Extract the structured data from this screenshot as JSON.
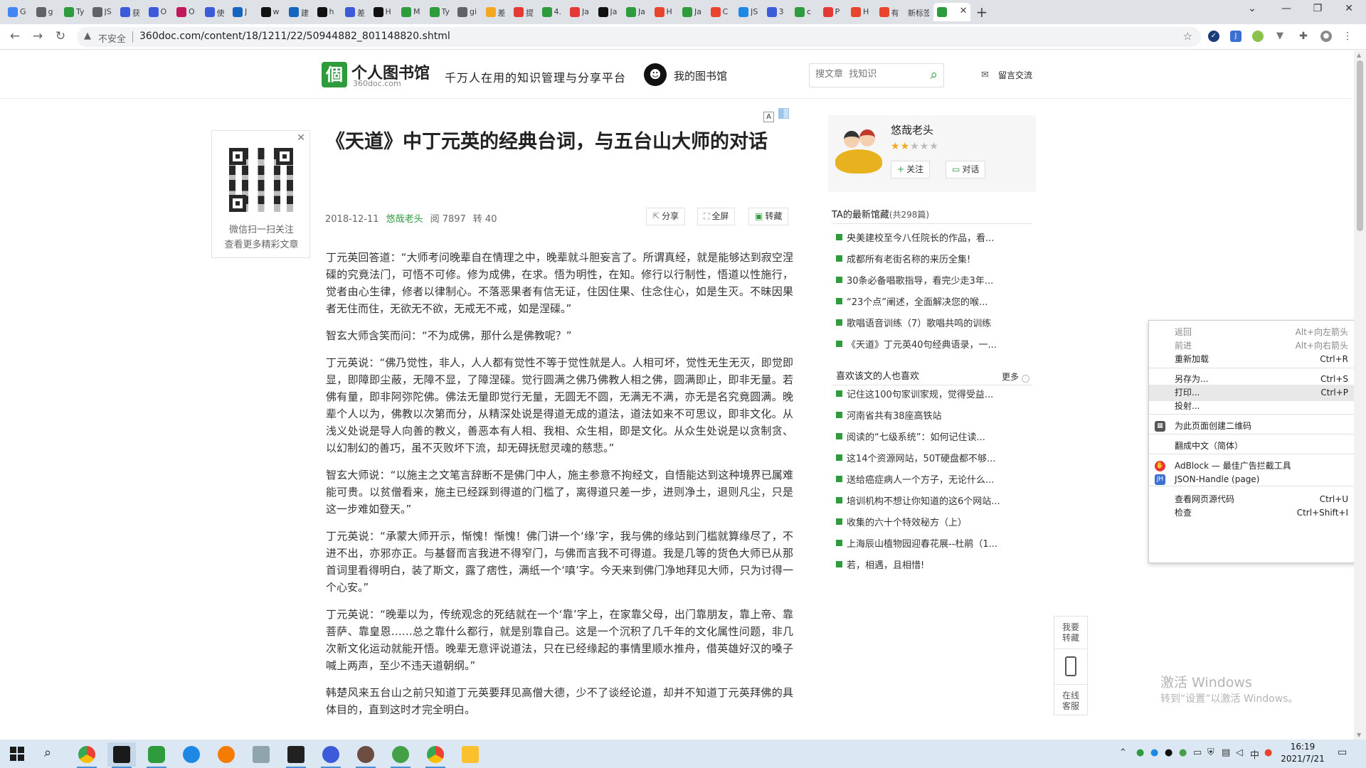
{
  "browser": {
    "tabs": [
      {
        "label": "G",
        "color": "#4285f4"
      },
      {
        "label": "g",
        "color": "#5f6368"
      },
      {
        "label": "Ty",
        "color": "#2e9b3c"
      },
      {
        "label": "JS",
        "color": "#5f6368"
      },
      {
        "label": "获",
        "color": "#3b5bdb"
      },
      {
        "label": "O",
        "color": "#3b5bdb"
      },
      {
        "label": "O",
        "color": "#c2185b"
      },
      {
        "label": "使",
        "color": "#3b5bdb"
      },
      {
        "label": "J",
        "color": "#1565c0"
      },
      {
        "label": "w",
        "color": "#111111"
      },
      {
        "label": "建",
        "color": "#1565c0"
      },
      {
        "label": "h",
        "color": "#111111"
      },
      {
        "label": "差",
        "color": "#3b5bdb"
      },
      {
        "label": "H",
        "color": "#111111"
      },
      {
        "label": "M",
        "color": "#2e9b3c"
      },
      {
        "label": "Ty",
        "color": "#2e9b3c"
      },
      {
        "label": "gi",
        "color": "#5f6368"
      },
      {
        "label": "差",
        "color": "#f5a623"
      },
      {
        "label": "提",
        "color": "#e53935"
      },
      {
        "label": "4.",
        "color": "#2e9b3c"
      },
      {
        "label": "Ja",
        "color": "#e53935"
      },
      {
        "label": "Ja",
        "color": "#111111"
      },
      {
        "label": "Ja",
        "color": "#2e9b3c"
      },
      {
        "label": "H",
        "color": "#e8452c"
      },
      {
        "label": "Ja",
        "color": "#2e9b3c"
      },
      {
        "label": "C",
        "color": "#e8452c"
      },
      {
        "label": "JS",
        "color": "#1e88e5"
      },
      {
        "label": "3",
        "color": "#3b5bdb"
      },
      {
        "label": "c",
        "color": "#2e9b3c"
      },
      {
        "label": "P",
        "color": "#e53935"
      },
      {
        "label": "H",
        "color": "#e8452c"
      },
      {
        "label": "有",
        "color": "#e8452c"
      },
      {
        "label": "新标签",
        "color": ""
      }
    ],
    "active_tab": {
      "label": "",
      "color": "#2e9b3c"
    },
    "insecure_label": "不安全",
    "url": "360doc.com/content/18/1211/22/50944882_801148820.shtml",
    "new_tab_glyph": "+",
    "minimize_glyph": "—",
    "restore_glyph": "❐",
    "close_glyph": "✕"
  },
  "header": {
    "logo_char": "個",
    "logo_title": "个人图书馆",
    "logo_sub": "360doc.com",
    "slogan": "千万人在用的知识管理与分享平台",
    "my_library": "我的图书馆",
    "search_placeholder": "搜文章  找知识",
    "message_board": "留言交流"
  },
  "qr": {
    "line1": "微信扫一扫关注",
    "line2": "查看更多精彩文章"
  },
  "article": {
    "font_a": "A",
    "title": "《天道》中丁元英的经典台词，与五台山大师的对话",
    "date": "2018-12-11",
    "author": "悠哉老头",
    "reads": "阅 7897",
    "reposts": "转 40",
    "share": "分享",
    "fullscreen": "全屏",
    "collect": "转藏",
    "paragraphs": [
      "丁元英回答道：“大师考问晚辈自在情理之中，晚辈就斗胆妄言了。所谓真经，就是能够达到寂空涅磲的究竟法门，可悟不可修。修为成佛，在求。悟为明性，在知。修行以行制性，悟道以性施行，觉者由心生律，修者以律制心。不落恶果者有信无证，住因住果、住念住心，如是生灭。不昧因果者无住而住，无欲无不欲，无戒无不戒，如是涅磲。”",
      "智玄大师含笑而问：“不为成佛，那什么是佛教呢？”",
      "丁元英说：“佛乃觉性，非人，人人都有觉性不等于觉性就是人。人相可坏，觉性无生无灭，即觉即显，即障即尘蔽，无障不显，了障涅磲。觉行圆满之佛乃佛教人相之佛，圆满即止，即非无量。若佛有量，即非阿弥陀佛。佛法无量即觉行无量，无圆无不圆，无满无不满，亦无是名究竟圆满。晚辈个人以为，佛教以次第而分，从精深处说是得道无成的道法，道法如来不可思议，即非文化。从浅义处说是导人向善的教义，善恶本有人相、我相、众生相，即是文化。从众生处说是以贪制贪、以幻制幻的善巧，虽不灭败坏下流，却无碍抚慰灵魂的慈悲。”",
      "智玄大师说：“以施主之文笔言辞断不是佛门中人，施主参意不拘经文，自悟能达到这种境界已属难能可贵。以贫僧看来，施主已经踩到得道的门槛了，离得道只差一步，进则净土，退则凡尘，只是这一步难如登天。”",
      "丁元英说：“承蒙大师开示，惭愧！惭愧！佛门讲一个‘缘’字，我与佛的缘站到门槛就算缘尽了，不进不出，亦邪亦正。与基督而言我进不得窄门，与佛而言我不可得道。我是几等的货色大师已从那首词里看得明白，装了斯文，露了痞性，满纸一个‘嗔’字。今天来到佛门净地拜见大师，只为讨得一个心安。”",
      "丁元英说：“晚辈以为，传统观念的死结就在一个‘靠’字上，在家靠父母，出门靠朋友，靠上帝、靠菩萨、靠皇恩……总之靠什么都行，就是别靠自己。这是一个沉积了几千年的文化属性问题，非几次新文化运动就能开悟。晚辈无意评说道法，只在已经缘起的事情里顺水推舟，借英雄好汉的嗓子喊上两声，至少不违天道朝纲。”",
      "韩楚风来五台山之前只知道丁元英要拜见高僧大德，少不了谈经论道，却并不知道丁元英拜佛的具体目的，直到这时才完全明白。"
    ]
  },
  "profile": {
    "name": "悠哉老头",
    "rating": 2,
    "rating_max": 5,
    "follow": "关注",
    "chat": "对话"
  },
  "latest": {
    "title": "TA的最新馆藏",
    "count": "(共298篇)",
    "items": [
      "央美建校至今八任院长的作品，看...",
      "成都所有老街名称的来历全集!",
      "30条必备唱歌指导，看完少走3年...",
      "“23个点”阐述，全面解决您的喉...",
      "歌唱语音训练（7）歌唱共鸣的训练",
      "《天道》丁元英40句经典语录，一..."
    ]
  },
  "liked": {
    "title": "喜欢该文的人也喜欢",
    "more": "更多",
    "items": [
      "记住这100句家训家规，觉得受益...",
      "河南省共有38座高铁站",
      "阅读的“七级系统”：如何记住读...",
      "这14个资源网站，50T硬盘都不够...",
      "送给癌症病人一个方子，无论什么...",
      "培训机构不想让你知道的这6个网站...",
      "收集的六十个特效秘方（上）",
      "上海辰山植物园迎春花展--杜鹃（1...",
      "若，相遇，且相惜!"
    ]
  },
  "float": {
    "repost": "我要转藏",
    "service": "在线客服"
  },
  "context_menu": {
    "items": [
      {
        "label": "返回",
        "shortcut": "Alt+向左箭头",
        "disabled": true
      },
      {
        "label": "前进",
        "shortcut": "Alt+向右箭头",
        "disabled": true
      },
      {
        "label": "重新加载",
        "shortcut": "Ctrl+R",
        "disabled": false
      },
      {
        "label": "另存为...",
        "shortcut": "Ctrl+S",
        "disabled": false
      },
      {
        "label": "打印...",
        "shortcut": "Ctrl+P",
        "disabled": false
      },
      {
        "label": "投射...",
        "shortcut": "",
        "disabled": false
      },
      {
        "label": "为此页面创建二维码",
        "shortcut": "",
        "disabled": false
      },
      {
        "label": "翻成中文（简体）",
        "shortcut": "",
        "disabled": false
      },
      {
        "label": "AdBlock — 最佳广告拦截工具",
        "shortcut": "",
        "disabled": false
      },
      {
        "label": "JSON-Handle (page)",
        "shortcut": "",
        "disabled": false
      },
      {
        "label": "查看网页源代码",
        "shortcut": "Ctrl+U",
        "disabled": false
      },
      {
        "label": "检查",
        "shortcut": "Ctrl+Shift+I",
        "disabled": false
      }
    ],
    "highlighted": "打印...",
    "submenu_arrow": "▶",
    "json_icon": "JH"
  },
  "watermark": {
    "line1": "激活 Windows",
    "line2": "转到“设置”以激活 Windows。"
  },
  "taskbar": {
    "time": "16:19",
    "date": "2021/7/21",
    "ime": "中"
  },
  "colors": {
    "brand_green": "#2e9b3c",
    "star": "#f5a623",
    "adblock_red": "#e53935",
    "json_blue": "#3b6fd1"
  }
}
